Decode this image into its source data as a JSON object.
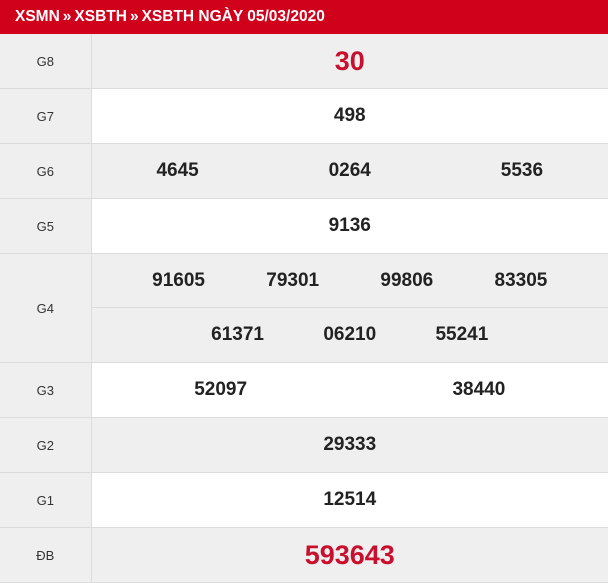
{
  "breadcrumb": {
    "items": [
      "XSMN",
      "XSBTH",
      "XSBTH NGÀY 05/03/2020"
    ],
    "separator": "»"
  },
  "colors": {
    "header_bg": "#d0021b",
    "special_number": "#c8102e",
    "row_shade": "#efefef"
  },
  "prizes": {
    "g8": {
      "label": "G8",
      "numbers": [
        "30"
      ]
    },
    "g7": {
      "label": "G7",
      "numbers": [
        "498"
      ]
    },
    "g6": {
      "label": "G6",
      "numbers": [
        "4645",
        "0264",
        "5536"
      ]
    },
    "g5": {
      "label": "G5",
      "numbers": [
        "9136"
      ]
    },
    "g4": {
      "label": "G4",
      "numbers": [
        "91605",
        "79301",
        "99806",
        "83305",
        "61371",
        "06210",
        "55241"
      ]
    },
    "g3": {
      "label": "G3",
      "numbers": [
        "52097",
        "38440"
      ]
    },
    "g2": {
      "label": "G2",
      "numbers": [
        "29333"
      ]
    },
    "g1": {
      "label": "G1",
      "numbers": [
        "12514"
      ]
    },
    "db": {
      "label": "ĐB",
      "numbers": [
        "593643"
      ]
    }
  }
}
